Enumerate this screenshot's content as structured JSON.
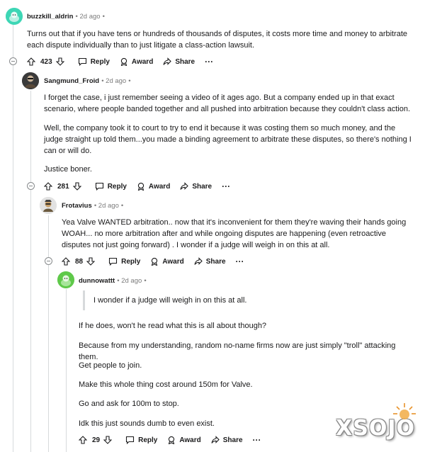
{
  "comments": [
    {
      "username": "buzzkill_aldrin",
      "age": "2d ago",
      "paragraphs": [
        "Turns out that if you have tens or hundreds of thousands of disputes, it costs more time and money to arbitrate each dispute individually than to just litigate a class-action lawsuit."
      ],
      "score": "423"
    },
    {
      "username": "Sangmund_Froid",
      "age": "2d ago",
      "paragraphs": [
        "I forget the case, i just remember seeing a video of it ages ago. But a company ended up in that exact scenario, where people banded together and all pushed into arbitration because they couldn't class action.",
        "Well, the company took it to court to try to end it because it was costing them so much money, and the judge straight up told them...you made a binding agreement to arbitrate these disputes, so there's nothing I can or will do.",
        "Justice boner."
      ],
      "score": "281"
    },
    {
      "username": "Frotavius",
      "age": "2d ago",
      "paragraphs": [
        "Yea Valve WANTED arbitration.. now that it's inconvenient for them they're waving their hands going WOAH... no more arbitration after and while ongoing disputes are happening (even retroactive disputes not just going forward) . I wonder if a judge will weigh in on this at all."
      ],
      "score": "88"
    },
    {
      "username": "dunnowattt",
      "age": "2d ago",
      "quote": "I wonder if a judge will weigh in on this at all.",
      "paragraphs": [
        "If he does, won't he read what this is all about though?",
        "Because from my understanding, random no-name firms now are just simply \"troll\" attacking them.",
        "Get people to join.",
        "Make this whole thing cost around 150m for Valve.",
        "Go and ask for 100m to stop.",
        "Idk this just sounds dumb to even exist."
      ],
      "score": "29"
    }
  ],
  "actions": {
    "reply": "Reply",
    "award": "Award",
    "share": "Share",
    "more": "···"
  },
  "watermark": "XSOJO",
  "colors": {
    "avatar1": "#3dd6b5",
    "avatar4": "#5fc94a",
    "thread": "#d7dadc",
    "meta": "#7c7c7c"
  }
}
